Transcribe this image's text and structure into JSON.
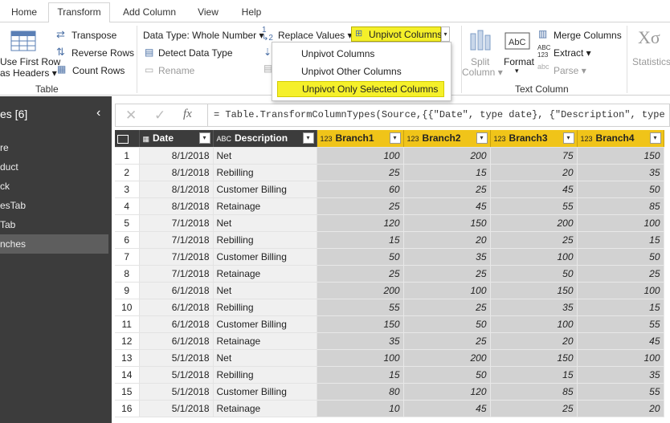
{
  "tabs": [
    "Home",
    "Transform",
    "Add Column",
    "View",
    "Help"
  ],
  "ribbon": {
    "table_group": {
      "use_first_row_line1": "Use First Row",
      "use_first_row_line2": "as Headers",
      "transpose": "Transpose",
      "reverse_rows": "Reverse Rows",
      "count_rows": "Count Rows",
      "label": "Table"
    },
    "any_column": {
      "data_type": "Data Type: Whole Number",
      "replace_values": "Replace Values",
      "unpivot_columns": "Unpivot Columns",
      "detect_data_type": "Detect Data Type",
      "rename": "Rename"
    },
    "text_column": {
      "split_column_line1": "Split",
      "split_column_line2": "Column",
      "format": "Format",
      "merge_columns": "Merge Columns",
      "extract": "Extract",
      "parse": "Parse",
      "label": "Text Column"
    },
    "statistics": "Statistics"
  },
  "unpivot_menu": {
    "items": [
      "Unpivot Columns",
      "Unpivot Other Columns",
      "Unpivot Only Selected Columns"
    ],
    "highlighted": "Unpivot Only Selected Columns"
  },
  "queries_pane": {
    "header": "es [6]",
    "items": [
      "re",
      "duct",
      "ck",
      "esTab",
      "Tab",
      "nches"
    ],
    "selected": "nches"
  },
  "formula_bar": {
    "fx": "fx",
    "formula": "= Table.TransformColumnTypes(Source,{{\"Date\", type date}, {\"Description\", type text},"
  },
  "grid": {
    "columns": [
      {
        "name": "Date",
        "type": "date"
      },
      {
        "name": "Description",
        "type": "ABC"
      },
      {
        "name": "Branch1",
        "type": "123"
      },
      {
        "name": "Branch2",
        "type": "123"
      },
      {
        "name": "Branch3",
        "type": "123"
      },
      {
        "name": "Branch4",
        "type": "123"
      }
    ],
    "rows": [
      {
        "n": "1",
        "date": "8/1/2018",
        "desc": "Net",
        "b1": "100",
        "b2": "200",
        "b3": "75",
        "b4": "150"
      },
      {
        "n": "2",
        "date": "8/1/2018",
        "desc": "Rebilling",
        "b1": "25",
        "b2": "15",
        "b3": "20",
        "b4": "35"
      },
      {
        "n": "3",
        "date": "8/1/2018",
        "desc": "Customer Billing",
        "b1": "60",
        "b2": "25",
        "b3": "45",
        "b4": "50"
      },
      {
        "n": "4",
        "date": "8/1/2018",
        "desc": "Retainage",
        "b1": "25",
        "b2": "45",
        "b3": "55",
        "b4": "85"
      },
      {
        "n": "5",
        "date": "7/1/2018",
        "desc": "Net",
        "b1": "120",
        "b2": "150",
        "b3": "200",
        "b4": "100"
      },
      {
        "n": "6",
        "date": "7/1/2018",
        "desc": "Rebilling",
        "b1": "15",
        "b2": "20",
        "b3": "25",
        "b4": "15"
      },
      {
        "n": "7",
        "date": "7/1/2018",
        "desc": "Customer Billing",
        "b1": "50",
        "b2": "35",
        "b3": "100",
        "b4": "50"
      },
      {
        "n": "8",
        "date": "7/1/2018",
        "desc": "Retainage",
        "b1": "25",
        "b2": "25",
        "b3": "50",
        "b4": "25"
      },
      {
        "n": "9",
        "date": "6/1/2018",
        "desc": "Net",
        "b1": "200",
        "b2": "100",
        "b3": "150",
        "b4": "100"
      },
      {
        "n": "10",
        "date": "6/1/2018",
        "desc": "Rebilling",
        "b1": "55",
        "b2": "25",
        "b3": "35",
        "b4": "15"
      },
      {
        "n": "11",
        "date": "6/1/2018",
        "desc": "Customer Billing",
        "b1": "150",
        "b2": "50",
        "b3": "100",
        "b4": "55"
      },
      {
        "n": "12",
        "date": "6/1/2018",
        "desc": "Retainage",
        "b1": "35",
        "b2": "25",
        "b3": "20",
        "b4": "45"
      },
      {
        "n": "13",
        "date": "5/1/2018",
        "desc": "Net",
        "b1": "100",
        "b2": "200",
        "b3": "150",
        "b4": "100"
      },
      {
        "n": "14",
        "date": "5/1/2018",
        "desc": "Rebilling",
        "b1": "15",
        "b2": "50",
        "b3": "15",
        "b4": "35"
      },
      {
        "n": "15",
        "date": "5/1/2018",
        "desc": "Customer Billing",
        "b1": "80",
        "b2": "120",
        "b3": "85",
        "b4": "55"
      },
      {
        "n": "16",
        "date": "5/1/2018",
        "desc": "Retainage",
        "b1": "10",
        "b2": "45",
        "b3": "25",
        "b4": "20"
      }
    ]
  },
  "colors": {
    "highlight_yellow": "#f5f02a",
    "selected_column_header": "#f0c419",
    "dark_pane": "#3c3c3c"
  }
}
